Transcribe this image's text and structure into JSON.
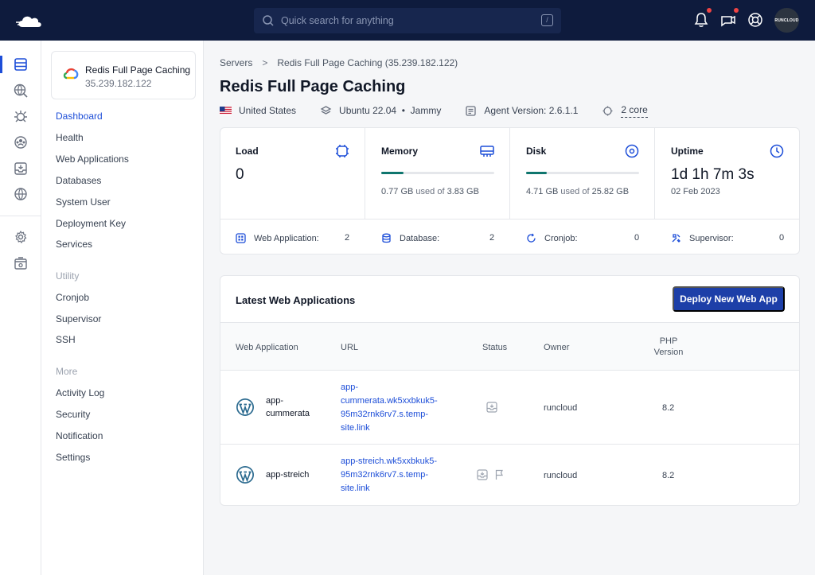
{
  "topbar": {
    "search_placeholder": "Quick search for anything",
    "shortcut_key": "/",
    "avatar_text": "RUNCLOUD",
    "notification_dot_color": "#ef4444"
  },
  "rail": {
    "icons": [
      "servers-icon",
      "web-globe-icon",
      "bug-icon",
      "team-icon",
      "inbox-icon",
      "globe-icon",
      "settings-icon",
      "archive-icon"
    ]
  },
  "server_card": {
    "name": "Redis Full Page Caching",
    "ip": "35.239.182.122"
  },
  "nav": {
    "main": [
      "Dashboard",
      "Health",
      "Web Applications",
      "Databases",
      "System User",
      "Deployment Key",
      "Services"
    ],
    "utility_heading": "Utility",
    "utility": [
      "Cronjob",
      "Supervisor",
      "SSH"
    ],
    "more_heading": "More",
    "more": [
      "Activity Log",
      "Security",
      "Notification",
      "Settings"
    ]
  },
  "breadcrumb": {
    "root": "Servers",
    "separator": ">",
    "current": "Redis Full Page Caching (35.239.182.122)"
  },
  "page_title": "Redis Full Page Caching",
  "meta": {
    "country": "United States",
    "os": "Ubuntu 22.04",
    "codename": "Jammy",
    "os_sep": "•",
    "agent": "Agent Version: 2.6.1.1",
    "cores": "2 core"
  },
  "stats": {
    "load": {
      "label": "Load",
      "value": "0"
    },
    "memory": {
      "label": "Memory",
      "used": "0.77 GB",
      "used_of": "used of",
      "total": "3.83 GB",
      "fraction": 0.2
    },
    "disk": {
      "label": "Disk",
      "used": "4.71 GB",
      "used_of": "used of",
      "total": "25.82 GB",
      "fraction": 0.182
    },
    "uptime": {
      "label": "Uptime",
      "value": "1d 1h 7m 3s",
      "date": "02 Feb 2023"
    },
    "counts": [
      {
        "label": "Web Application:",
        "value": "2"
      },
      {
        "label": "Database:",
        "value": "2"
      },
      {
        "label": "Cronjob:",
        "value": "0"
      },
      {
        "label": "Supervisor:",
        "value": "0"
      }
    ],
    "bar_color": "#0f766e"
  },
  "apps": {
    "heading": "Latest Web Applications",
    "deploy_label": "Deploy New Web App",
    "columns": {
      "app": "Web Application",
      "url": "URL",
      "status": "Status",
      "owner": "Owner",
      "php_1": "PHP",
      "php_2": "Version"
    },
    "rows": [
      {
        "name_1": "app-",
        "name_2": "cummerata",
        "url_1": "app-",
        "url_2": "cummerata.wk5xxbkuk5-",
        "url_3": "95m32rnk6rv7.s.temp-",
        "url_4": "site.link",
        "owner": "runcloud",
        "php": "8.2"
      },
      {
        "name": "app-streich",
        "url_1": "app-streich.wk5xxbkuk5-",
        "url_2": "95m32rnk6rv7.s.temp-",
        "url_3": "site.link",
        "owner": "runcloud",
        "php": "8.2"
      }
    ]
  },
  "colors": {
    "topbar": "#0e1b3d",
    "primary": "#1d3fa8",
    "link": "#1d4ed8"
  }
}
